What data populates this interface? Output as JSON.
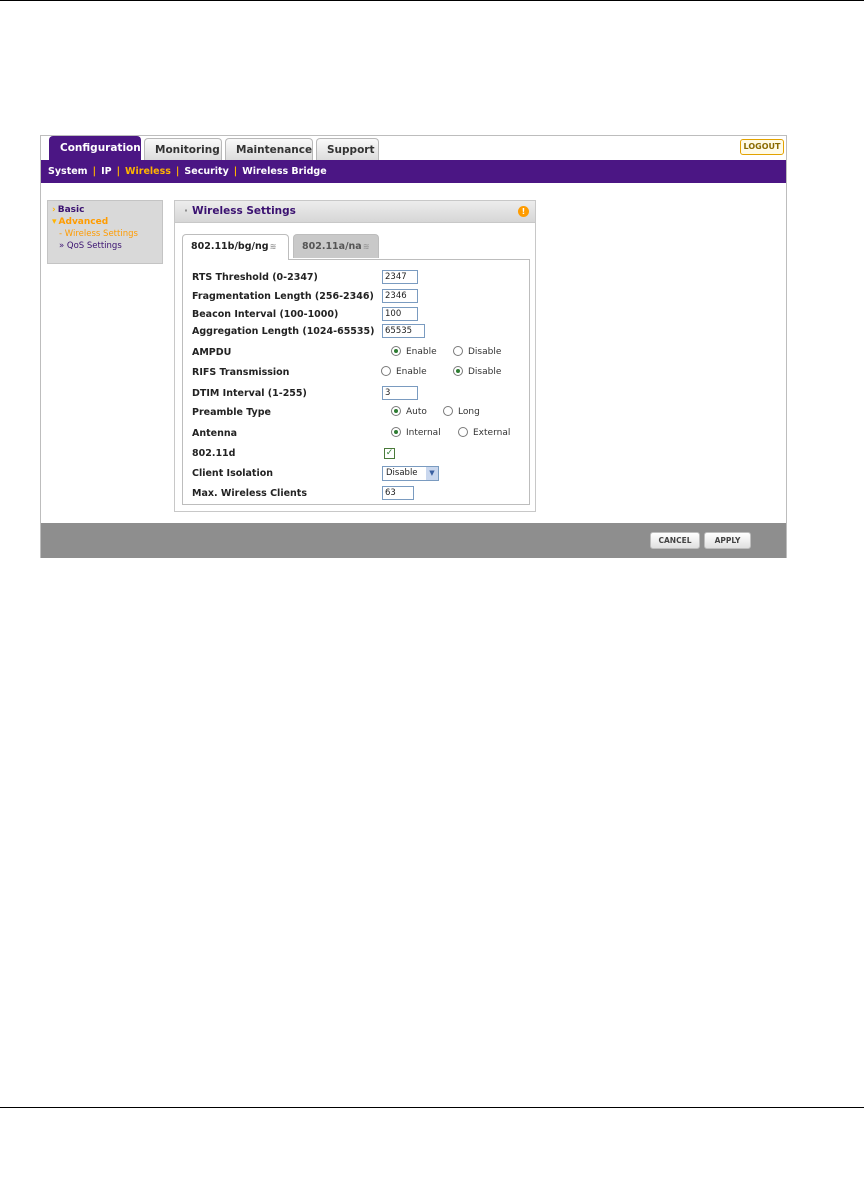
{
  "main_tabs": [
    {
      "label": "Configuration",
      "active": true
    },
    {
      "label": "Monitoring"
    },
    {
      "label": "Maintenance"
    },
    {
      "label": "Support"
    }
  ],
  "logout_label": "LOGOUT",
  "subnav": [
    {
      "label": "System"
    },
    {
      "label": "IP"
    },
    {
      "label": "Wireless",
      "active": true
    },
    {
      "label": "Security"
    },
    {
      "label": "Wireless Bridge"
    }
  ],
  "sidebar": {
    "basic": "Basic",
    "advanced": "Advanced",
    "items": [
      "Wireless Settings",
      "QoS Settings"
    ]
  },
  "panel": {
    "title": "Wireless Settings",
    "tabs": [
      "802.11b/bg/ng",
      "802.11a/na"
    ]
  },
  "form": {
    "rts_threshold": {
      "label": "RTS Threshold (0-2347)",
      "value": "2347"
    },
    "fragmentation_length": {
      "label": "Fragmentation Length (256-2346)",
      "value": "2346"
    },
    "beacon_interval": {
      "label": "Beacon Interval (100-1000)",
      "value": "100"
    },
    "aggregation_length": {
      "label": "Aggregation Length (1024-65535)",
      "value": "65535"
    },
    "ampdu": {
      "label": "AMPDU",
      "options": [
        "Enable",
        "Disable"
      ],
      "selected": "Enable"
    },
    "rifs_transmission": {
      "label": "RIFS Transmission",
      "options": [
        "Enable",
        "Disable"
      ],
      "selected": "Disable"
    },
    "dtim_interval": {
      "label": "DTIM Interval (1-255)",
      "value": "3"
    },
    "preamble_type": {
      "label": "Preamble Type",
      "options": [
        "Auto",
        "Long"
      ],
      "selected": "Auto"
    },
    "antenna": {
      "label": "Antenna",
      "options": [
        "Internal",
        "External"
      ],
      "selected": "Internal"
    },
    "d80211": {
      "label": "802.11d",
      "checked": true
    },
    "client_isolation": {
      "label": "Client Isolation",
      "value": "Disable"
    },
    "max_wireless_clients": {
      "label": "Max. Wireless Clients",
      "value": "63"
    }
  },
  "footer": {
    "cancel": "CANCEL",
    "apply": "APPLY"
  },
  "colors": {
    "brand_purple": "#4b1684",
    "accent_orange": "#ffb400",
    "footer_gray": "#8e8e8e"
  }
}
